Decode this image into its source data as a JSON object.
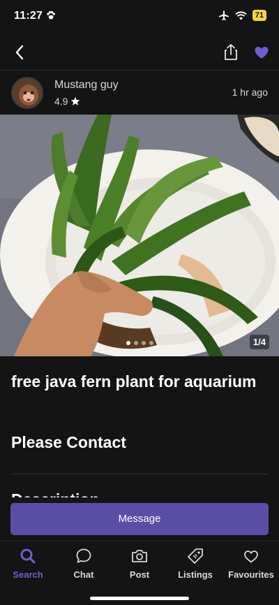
{
  "status": {
    "time": "11:27",
    "battery": "71"
  },
  "seller": {
    "name": "Mustang guy",
    "rating": "4.9",
    "posted": "1 hr ago"
  },
  "photo": {
    "counter": "1/4",
    "dots": 4,
    "active_dot": 0
  },
  "listing": {
    "title": "free java fern plant for aquarium",
    "price": "Please Contact",
    "section_heading": "Description"
  },
  "actions": {
    "message_label": "Message"
  },
  "nav": {
    "search": "Search",
    "chat": "Chat",
    "post": "Post",
    "listings": "Listings",
    "favourites": "Favourites"
  },
  "colors": {
    "accent": "#5b4ea6",
    "accent_text": "#6d5fd0",
    "background": "#141414",
    "battery": "#f5d53d"
  }
}
